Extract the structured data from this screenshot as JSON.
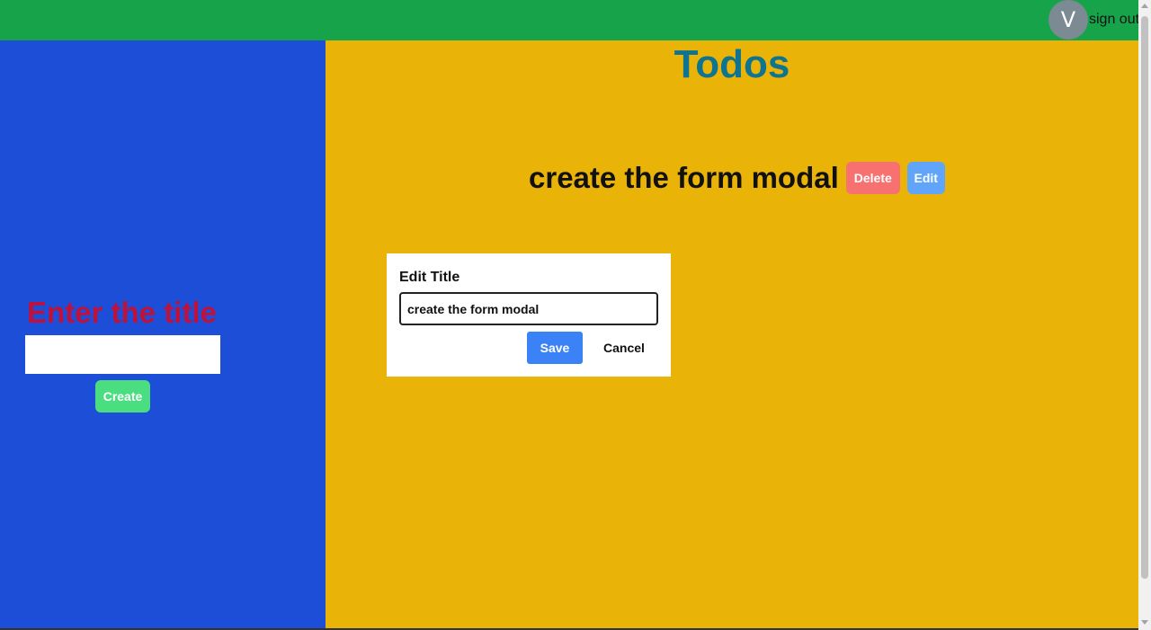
{
  "header": {
    "avatar_initial": "V",
    "signout_label": "sign out",
    "bg_color": "#16a34a"
  },
  "sidebar": {
    "heading": "Enter the title",
    "input_value": "",
    "create_label": "Create",
    "bg_color": "#1d4ed8"
  },
  "main": {
    "title": "Todos",
    "bg_color": "#eab308",
    "todos": [
      {
        "title": "create the form modal",
        "delete_label": "Delete",
        "edit_label": "Edit"
      }
    ]
  },
  "modal": {
    "title": "Edit Title",
    "input_value": "create the form modal",
    "save_label": "Save",
    "cancel_label": "Cancel"
  }
}
